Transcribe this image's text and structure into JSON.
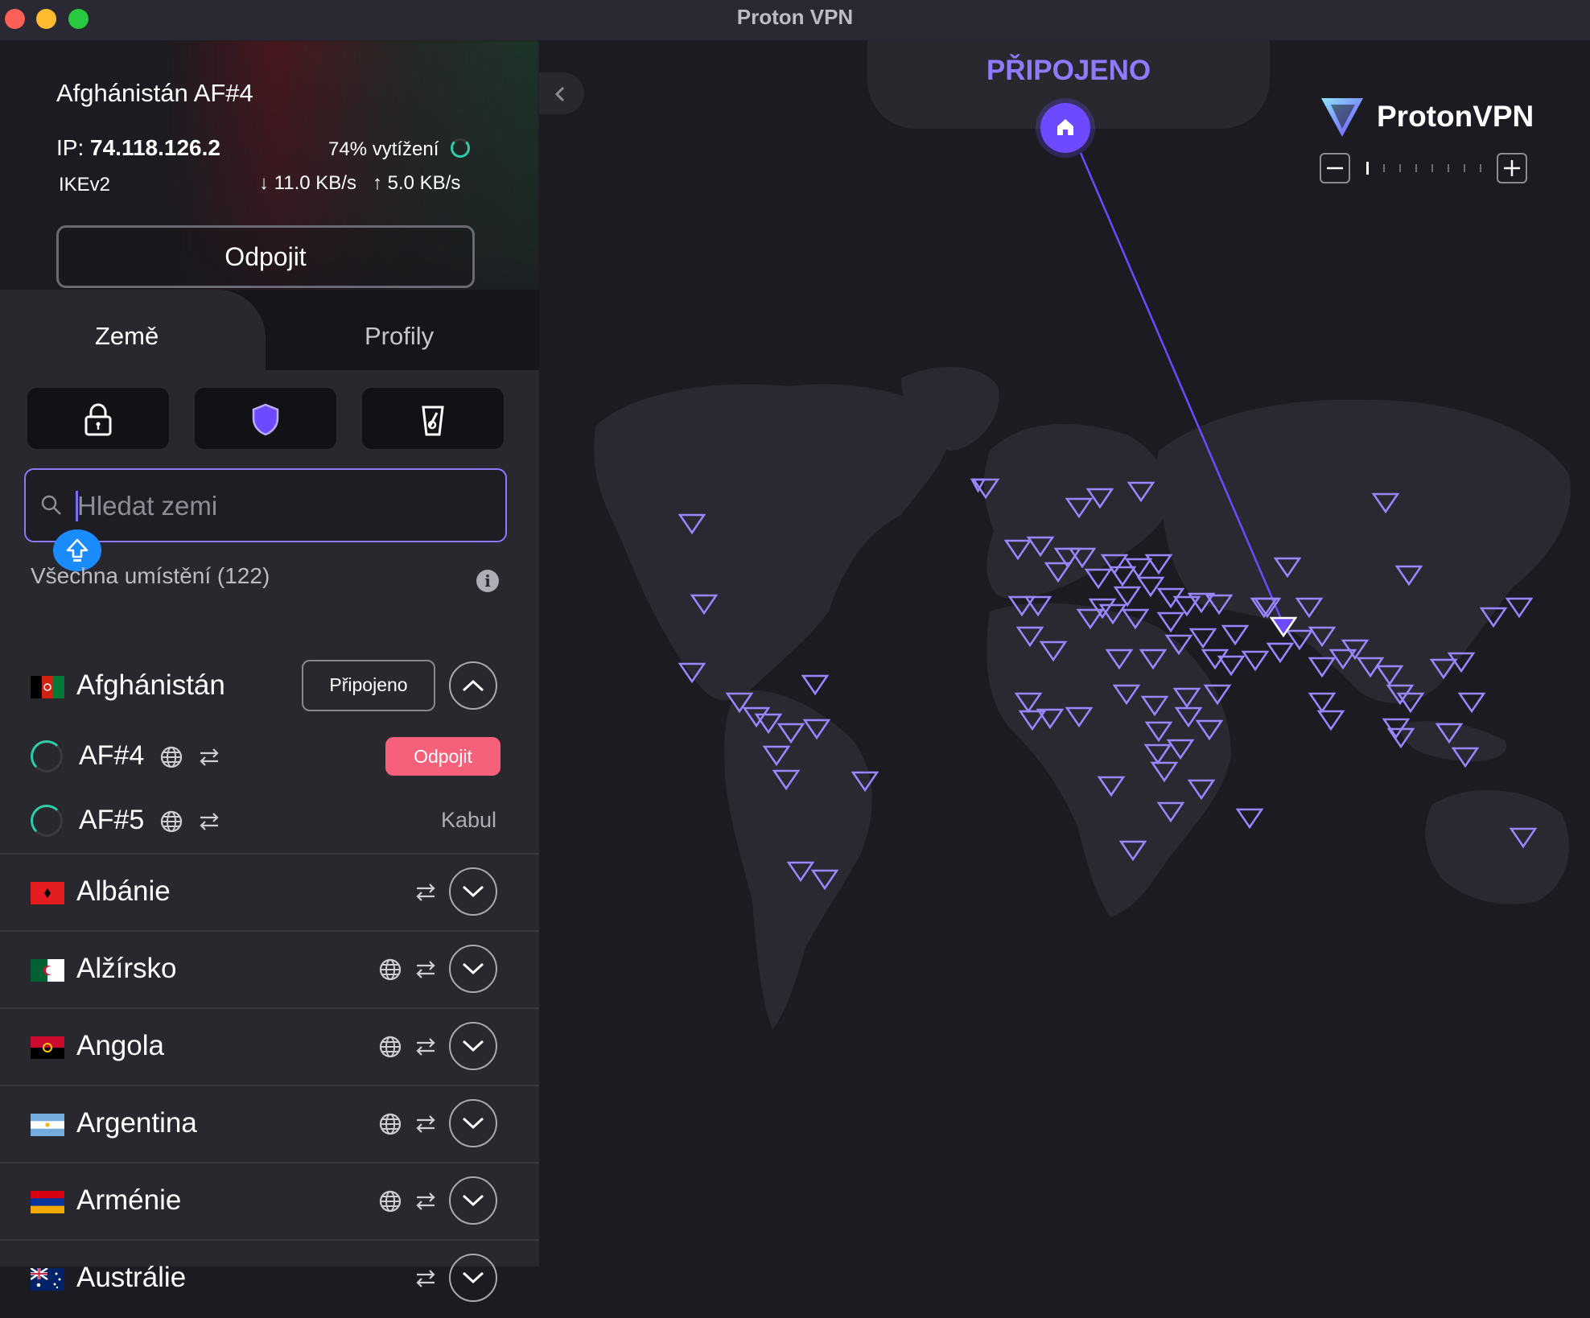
{
  "window": {
    "title": "Proton VPN"
  },
  "connection": {
    "server": "Afghánistán AF#4",
    "ip_label": "IP: ",
    "ip": "74.118.126.2",
    "load": "74% vytížení",
    "protocol": "IKEv2",
    "download": "↓ 11.0 KB/s",
    "upload": "↑ 5.0 KB/s",
    "disconnect_label": "Odpojit"
  },
  "tabs": {
    "countries": "Země",
    "profiles": "Profily"
  },
  "search": {
    "placeholder": "Hledat zemi"
  },
  "locations": {
    "label": "Všechna umístění (122)"
  },
  "countries": [
    {
      "name": "Afghánistán",
      "status": "Připojeno",
      "expanded": true
    },
    {
      "name": "Albánie"
    },
    {
      "name": "Alžírsko"
    },
    {
      "name": "Angola"
    },
    {
      "name": "Argentina"
    },
    {
      "name": "Arménie"
    },
    {
      "name": "Austrálie"
    }
  ],
  "servers": [
    {
      "name": "AF#4",
      "action": "Odpojit"
    },
    {
      "name": "AF#5",
      "city": "Kabul"
    }
  ],
  "map": {
    "status": "PŘIPOJENO",
    "brand": "ProtonVPN"
  },
  "colors": {
    "accent": "#6d4aff",
    "status_text": "#8e7bff",
    "load_ring": "#2ecfa8",
    "disconnect_red": "#f7607a",
    "search_border": "#8c78ff"
  }
}
